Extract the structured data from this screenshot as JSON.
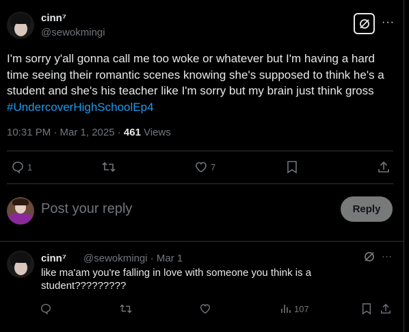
{
  "post": {
    "author_name": "cinn⁷",
    "author_handle": "@sewokmingi",
    "text_main": "I'm sorry y'all gonna call me too woke or whatever but I'm having a hard time seeing their romantic scenes knowing she's supposed to think he's a student and she's his teacher like I'm sorry but my brain just think gross",
    "hashtag": "#UndercoverHighSchoolEp4",
    "time": "10:31 PM · Mar 1, 2025 · ",
    "views_count": "461",
    "views_label": " Views",
    "reply_count": "1",
    "like_count": "7"
  },
  "reply_box": {
    "placeholder": "Post your reply",
    "button_label": "Reply"
  },
  "reply": {
    "author_name": "cinn⁷",
    "author_handle": "@sewokmingi · Mar 1",
    "text": "like ma'am you're falling in love with someone you think is a student?????????",
    "views_count": "107"
  },
  "icons": [
    "grok-icon",
    "more-icon",
    "reply-icon",
    "repost-icon",
    "like-icon",
    "bookmark-icon",
    "share-icon",
    "views-icon"
  ],
  "colors": {
    "accent": "#1d9bf0",
    "muted": "#71767b",
    "text": "#e7e9ea",
    "button": "#787a7a"
  }
}
